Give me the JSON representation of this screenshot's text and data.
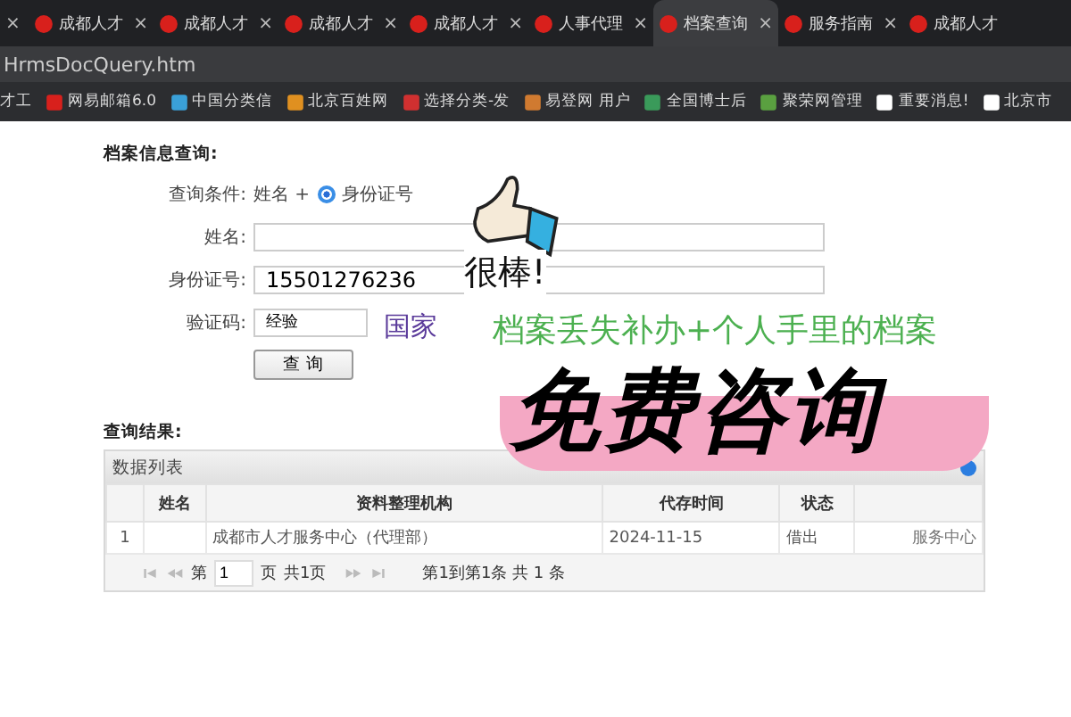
{
  "browser": {
    "tabs": [
      {
        "close": "×",
        "selected": false
      },
      {
        "label": "成都人才",
        "close": "×",
        "selected": false
      },
      {
        "label": "成都人才",
        "close": "×",
        "selected": false
      },
      {
        "label": "成都人才",
        "close": "×",
        "selected": false
      },
      {
        "label": "成都人才",
        "close": "×",
        "selected": false
      },
      {
        "label": "人事代理",
        "close": "×",
        "selected": false
      },
      {
        "label": "档案查询",
        "close": "×",
        "selected": true
      },
      {
        "label": "服务指南",
        "close": "×",
        "selected": false
      },
      {
        "label": "成都人才",
        "selected": false
      }
    ],
    "address": "HrmsDocQuery.htm",
    "bookmarks": [
      "才工",
      "网易邮箱6.0",
      "中国分类信",
      "北京百姓网",
      "选择分类-发",
      "易登网 用户",
      "全国博士后",
      "聚荣网管理",
      "重要消息!",
      "北京市"
    ]
  },
  "form": {
    "title": "档案信息查询:",
    "condition_label": "查询条件:",
    "condition_prefix": "姓名 +",
    "options": [
      {
        "label": "身份证号",
        "selected": true
      }
    ],
    "fields": [
      {
        "label": "姓名:"
      },
      {
        "label": "身份证号:",
        "value": "15501276236"
      }
    ],
    "captcha": {
      "label": "验证码:",
      "value": "经验"
    },
    "button": "查 询"
  },
  "results": {
    "title": "查询结果:",
    "panel_title": "数据列表",
    "columns": [
      "",
      "姓名",
      "资料整理机构",
      "代存时间",
      "状态",
      ""
    ],
    "rows": [
      [
        "1",
        "",
        "成都市人才服务中心（代理部）",
        "2024-11-15",
        "借出",
        "服务中心"
      ]
    ],
    "pager": {
      "page_prefix": "第",
      "page": "1",
      "page_suffix": "页",
      "total_pages": "共1页",
      "summary": "第1到第1条   共 1 条"
    }
  },
  "stickers": {
    "praise": "很棒!",
    "country": "国家",
    "headline": "档案丢失补办+个人手里的档案",
    "banner": "免费咨询"
  }
}
